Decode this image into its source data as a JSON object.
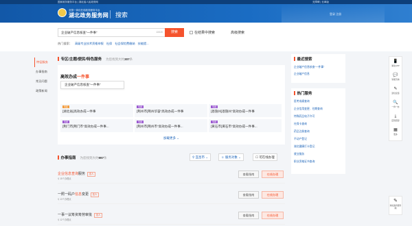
{
  "topbar": {
    "left_text": "国家政务服务平台 | 湖北省人民政府网",
    "right_text": "无障碍 | 长辈版"
  },
  "header": {
    "site_subtitle": "全国一体化在线政务服务平台",
    "site_name": "湖北政务服务网",
    "page_title": "搜索",
    "login_text": "登录 注册"
  },
  "search": {
    "value": "企业破产信息核查“一件事”",
    "count": "13/120",
    "button": "搜索",
    "in_result": "在结果中搜索",
    "advanced": "高级搜索",
    "hot_label": "热门搜索：",
    "hot_items": [
      "高级专业技术资格申报",
      "社保",
      "社会保险费缴纳",
      "技能提..."
    ]
  },
  "leftnav": {
    "items": [
      "特征服务",
      "办事指南",
      "常见问题",
      "政策新闻"
    ]
  },
  "theme_section": {
    "heading": "专区/主题/便民/特色服务",
    "found_prefix": "为您找到大约",
    "found_count": "307",
    "found_suffix": "条",
    "title_normal": "高效办成",
    "title_highlight": "一件事",
    "card_text": "企业破产信息核查“一件事”",
    "grid": [
      {
        "tag": "专区",
        "tag_color": "#f39c3d",
        "text": "[湖北省]高效办成一件事"
      },
      {
        "tag": "专题",
        "tag_color": "#9b59d0",
        "text": "[荆州市]荆州华容“高效办成一件事"
      },
      {
        "tag": "专题",
        "tag_color": "#9b59d0",
        "text": "[恩施州]恩施州“高效办成一件事"
      },
      {
        "tag": "专题",
        "tag_color": "#9b59d0",
        "text": "[荆门市]荆门市“高效办成一件事..."
      },
      {
        "tag": "专题",
        "tag_color": "#9b59d0",
        "text": "[荆州市]荆州市“高效办成一件事..."
      },
      {
        "tag": "专题",
        "tag_color": "#9b59d0",
        "text": "[黄石市]黄石市“高效办成一件事..."
      }
    ],
    "load_more": "加载更多 ⌄"
  },
  "guide_section": {
    "heading": "办事指南",
    "found_prefix": "为您找到大约",
    "found_count": "997",
    "found_suffix": "条",
    "filter_location": "宜昌市",
    "filter_target": "服务对象",
    "filter_online": "可在线办理",
    "rows": [
      {
        "pre": "",
        "hl": "企业信息查询",
        "post": "服务",
        "badge": "法人",
        "meta": "15个办理点",
        "btn_guide": "查看指南",
        "btn_online": "在线办理"
      },
      {
        "pre": "一照一码户",
        "hl": "信息",
        "post": "变更",
        "badge": "法人",
        "meta": "13个办理点",
        "btn_guide": "查看指南",
        "btn_online": "在线办理"
      },
      {
        "pre": "一事一议筹资筹劳审批",
        "hl": "",
        "post": "",
        "badge": "法人",
        "meta": "12个办理点",
        "btn_guide": "查看指南",
        "btn_online": "在线办理"
      }
    ]
  },
  "recent": {
    "title": "最近搜索",
    "items": [
      "企业破产信息核查“一件事”",
      "企业破产信息"
    ]
  },
  "hot_services": {
    "title": "热门服务",
    "items": [
      "医考成绩查询",
      "企业信用变更、往期查询",
      "特殊药品电子许可",
      "社保卡查询",
      "药品注册查询",
      "不动产登记",
      "湖北健康打卡登记",
      "就业服务",
      "职业资格证书查询"
    ]
  },
  "float_toolbar": {
    "items": [
      {
        "icon": "📱",
        "label": "湖北APP"
      },
      {
        "icon": "💬",
        "label": "智能咨询"
      },
      {
        "icon": "✎",
        "label": "建议反馈"
      },
      {
        "icon": "🔍",
        "label": "一件一办"
      },
      {
        "icon": "⤓",
        "label": "回到顶部"
      },
      {
        "icon": "▦",
        "label": "更多"
      }
    ],
    "bottom_label": "湖北政务服务网"
  }
}
